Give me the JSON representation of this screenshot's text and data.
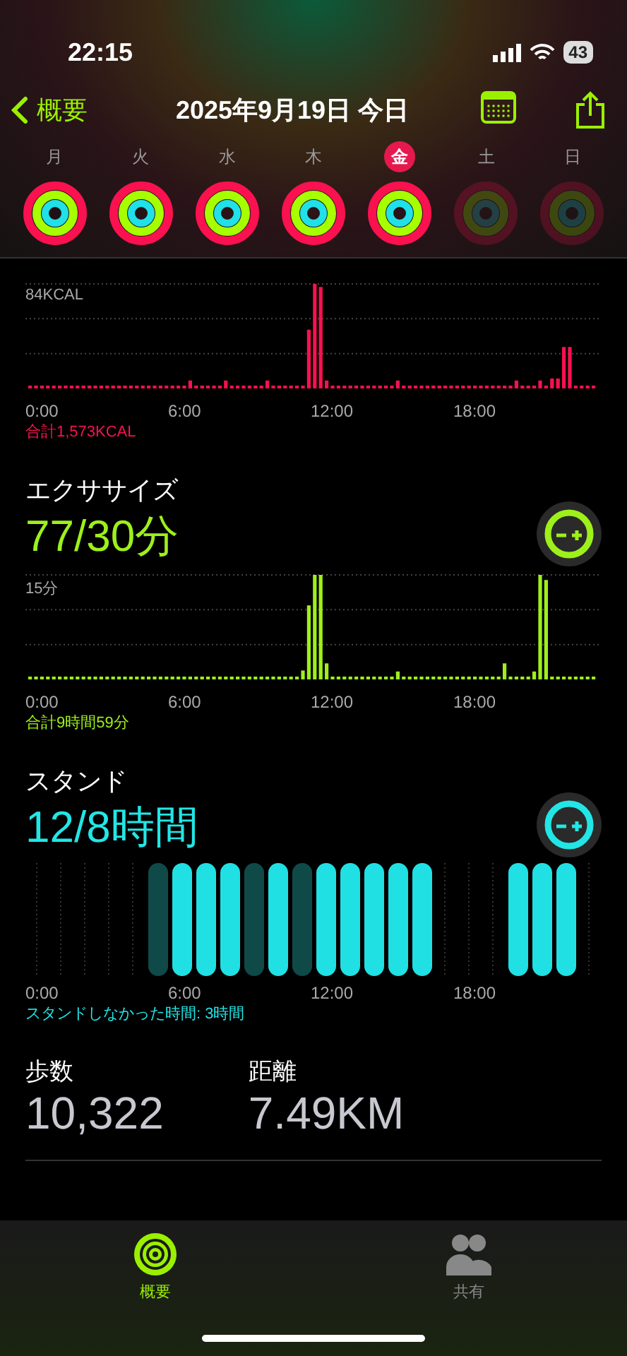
{
  "status_bar": {
    "time": "22:15",
    "battery": "43"
  },
  "nav": {
    "back": "概要",
    "title": "2025年9月19日 今日"
  },
  "days": [
    {
      "label": "月",
      "selected": false,
      "future": false
    },
    {
      "label": "火",
      "selected": false,
      "future": false
    },
    {
      "label": "水",
      "selected": false,
      "future": false
    },
    {
      "label": "木",
      "selected": false,
      "future": false
    },
    {
      "label": "金",
      "selected": true,
      "future": false
    },
    {
      "label": "土",
      "selected": false,
      "future": true
    },
    {
      "label": "日",
      "selected": false,
      "future": true
    }
  ],
  "sections": [
    {
      "kind": "move",
      "y_label": "84KCAL",
      "x_labels": [
        "0:00",
        "6:00",
        "12:00",
        "18:00"
      ],
      "total": "合計1,573KCAL"
    },
    {
      "kind": "exercise",
      "title": "エクササイズ",
      "value": "77/30分",
      "y_label": "15分",
      "x_labels": [
        "0:00",
        "6:00",
        "12:00",
        "18:00"
      ],
      "total": "合計9時間59分"
    },
    {
      "kind": "stand",
      "title": "スタンド",
      "value": "12/8時間",
      "x_labels": [
        "0:00",
        "6:00",
        "12:00",
        "18:00"
      ],
      "total": "スタンドしなかった時間: 3時間"
    }
  ],
  "stats": [
    {
      "label": "歩数",
      "value": "10,322"
    },
    {
      "label": "距離",
      "value": "7.49KM"
    }
  ],
  "tabs": [
    {
      "label": "概要",
      "selected": true
    },
    {
      "label": "共有",
      "selected": false
    }
  ]
}
